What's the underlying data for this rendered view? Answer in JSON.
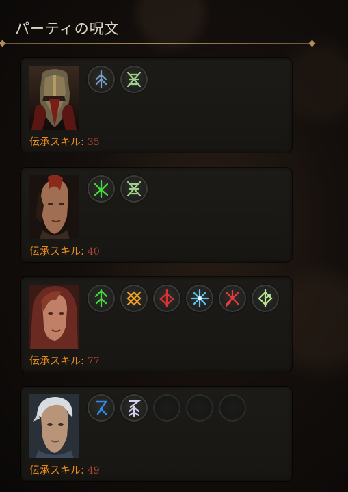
{
  "title": "パーティの呪文",
  "colors": {
    "skill_label": "#e88a1c",
    "skill_value": "#a84430",
    "divider": "#a88a58"
  },
  "party": [
    {
      "portrait": "masked-warrior",
      "skill_label": "伝承スキル:",
      "skill_value": "35",
      "runes": [
        {
          "icon": "rune-ice-icon",
          "color": "#7aa0c8"
        },
        {
          "icon": "rune-nature-icon",
          "color": "#9ed28a"
        }
      ]
    },
    {
      "portrait": "mohawk-woman",
      "skill_label": "伝承スキル:",
      "skill_value": "40",
      "runes": [
        {
          "icon": "rune-poison-icon",
          "color": "#44e03a"
        },
        {
          "icon": "rune-nature-icon",
          "color": "#9ed28a"
        }
      ]
    },
    {
      "portrait": "hooded-woman",
      "skill_label": "伝承スキル:",
      "skill_value": "77",
      "runes": [
        {
          "icon": "rune-arrow-icon",
          "color": "#44e03a"
        },
        {
          "icon": "rune-cross-icon",
          "color": "#f0a020"
        },
        {
          "icon": "rune-fire-icon",
          "color": "#e03030"
        },
        {
          "icon": "rune-star-icon",
          "color": "#5ac8f0"
        },
        {
          "icon": "rune-cross-red-icon",
          "color": "#f03a3a"
        },
        {
          "icon": "rune-leaf-icon",
          "color": "#b8e890"
        }
      ]
    },
    {
      "portrait": "white-haired-man",
      "skill_label": "伝承スキル:",
      "skill_value": "49",
      "runes": [
        {
          "icon": "rune-wind-icon",
          "color": "#2f8cf0"
        },
        {
          "icon": "rune-spirit-icon",
          "color": "#d8d0f0"
        },
        {
          "icon": "empty-slot-icon",
          "color": ""
        },
        {
          "icon": "empty-slot-icon",
          "color": ""
        },
        {
          "icon": "empty-slot-icon",
          "color": ""
        }
      ]
    }
  ]
}
